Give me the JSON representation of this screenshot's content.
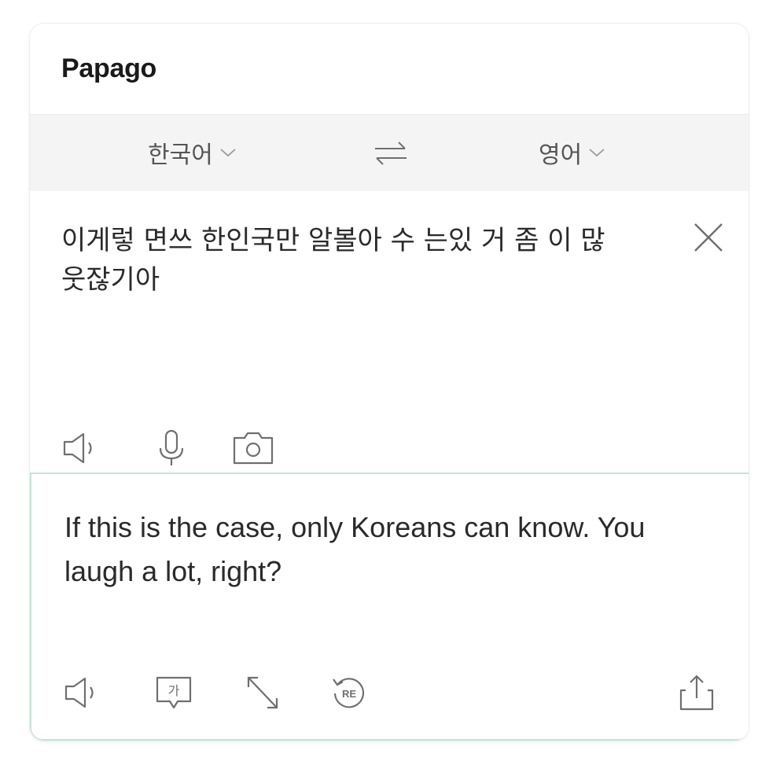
{
  "app": {
    "title": "Papago"
  },
  "languages": {
    "source": "한국어",
    "target": "영어"
  },
  "source": {
    "text": "이게렇 면쓰 한인국만 알볼아 수 는있 거 좀 이 많 웃잖기아"
  },
  "result": {
    "text": "If this is the case, only Koreans can know. You laugh a lot, right?"
  },
  "icons": {
    "swap": "swap-arrows-icon",
    "clear": "close-icon",
    "speaker": "speaker-icon",
    "mic": "microphone-icon",
    "camera": "camera-icon",
    "korean_glyph": "가",
    "re_glyph": "RE",
    "share": "share-icon"
  },
  "colors": {
    "accent_border": "#c6e3d6",
    "lang_bar": "#f3f4f3",
    "icon": "#6f6f6f"
  }
}
